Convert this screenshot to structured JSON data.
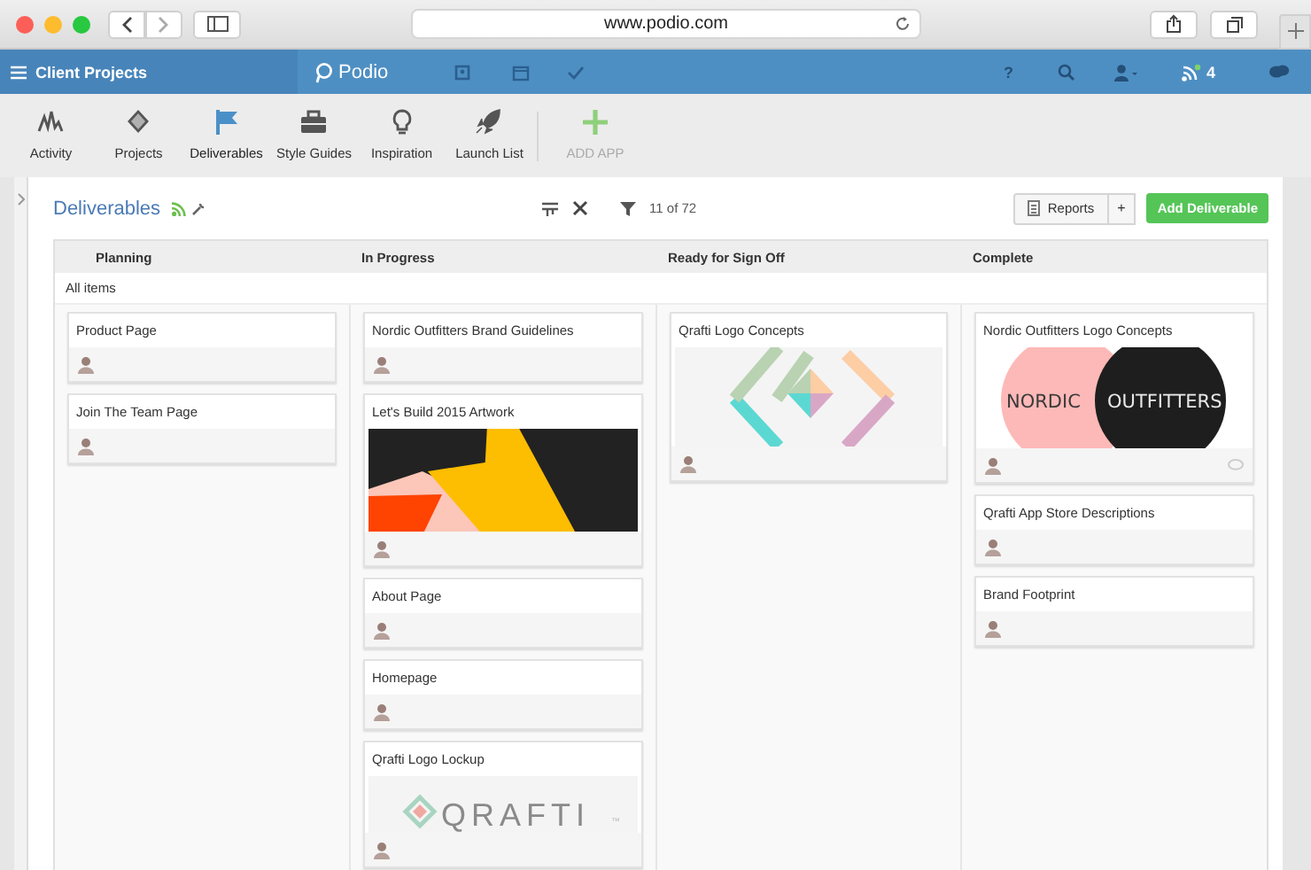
{
  "browser": {
    "url": "www.podio.com"
  },
  "topbar": {
    "workspace": "Client Projects",
    "brand": "Podio",
    "help": "?",
    "notifications": "4"
  },
  "apps": [
    {
      "label": "Activity",
      "kind": "app",
      "selected": false
    },
    {
      "label": "Projects",
      "kind": "app",
      "selected": false
    },
    {
      "label": "Deliverables",
      "kind": "app",
      "selected": true
    },
    {
      "label": "Style Guides",
      "kind": "app",
      "selected": false
    },
    {
      "label": "Inspiration",
      "kind": "app",
      "selected": false
    },
    {
      "label": "Launch List",
      "kind": "app",
      "selected": false
    },
    {
      "label": "ADD APP",
      "kind": "add",
      "selected": false
    }
  ],
  "header": {
    "title": "Deliverables",
    "count": "11 of 72",
    "reports": "Reports",
    "more": "+",
    "add": "Add Deliverable"
  },
  "board": {
    "group": "All items",
    "columns": [
      {
        "name": "Planning",
        "cards": [
          {
            "title": "Product Page",
            "comments": false
          },
          {
            "title": "Join The Team Page",
            "comments": false
          }
        ]
      },
      {
        "name": "In Progress",
        "cards": [
          {
            "title": "Nordic Outfitters Brand Guidelines",
            "comments": false
          },
          {
            "title": "Let's Build 2015 Artwork",
            "comments": false,
            "image": {
              "kind": "artwork"
            }
          },
          {
            "title": "About Page",
            "comments": false
          },
          {
            "title": "Homepage",
            "comments": false
          },
          {
            "title": "Qrafti Logo Lockup",
            "comments": false,
            "image": {
              "kind": "lockup",
              "words": [
                "QRAFTI",
                "™"
              ]
            }
          }
        ]
      },
      {
        "name": "Ready for Sign Off",
        "cards": [
          {
            "title": "Qrafti Logo Concepts",
            "comments": false,
            "image": {
              "kind": "diamond"
            }
          }
        ]
      },
      {
        "name": "Complete",
        "cards": [
          {
            "title": "Nordic Outfitters Logo Concepts",
            "comments": true,
            "image": {
              "kind": "wordmark",
              "words": [
                "NORDIC",
                "OUTFITTERS"
              ]
            }
          },
          {
            "title": "Qrafti App Store Descriptions",
            "comments": false
          },
          {
            "title": "Brand Footprint",
            "comments": false
          }
        ]
      }
    ]
  }
}
